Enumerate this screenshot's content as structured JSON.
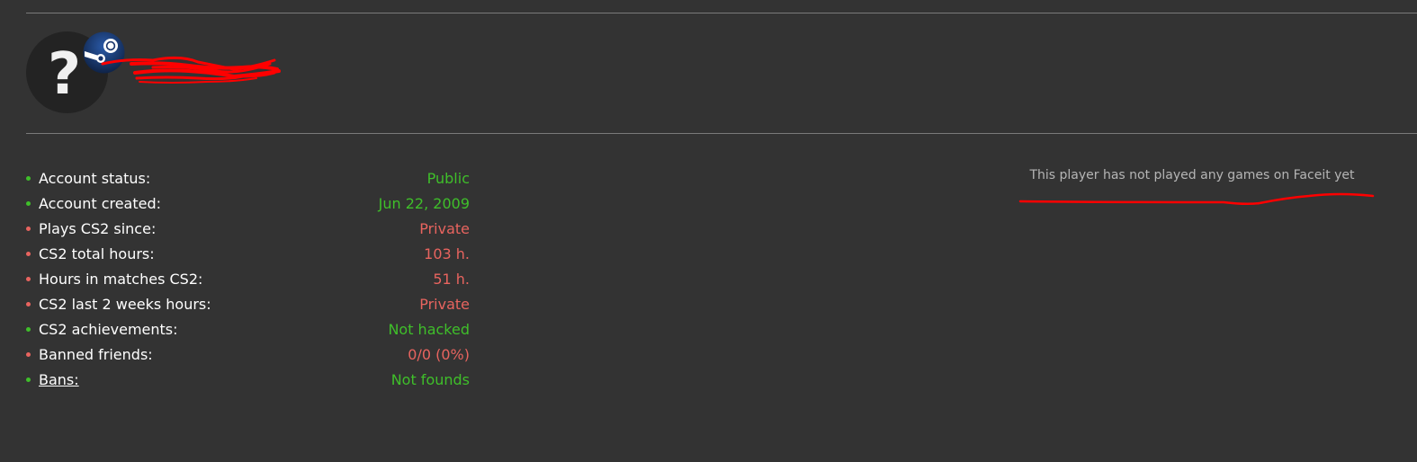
{
  "profile": {
    "avatar_glyph": "?",
    "badge_icon": "steam-icon",
    "name_redacted": true
  },
  "stats": [
    {
      "label": "Account status:",
      "value": "Public",
      "status": "good",
      "link": false
    },
    {
      "label": "Account created:",
      "value": "Jun 22, 2009",
      "status": "good",
      "link": false
    },
    {
      "label": "Plays CS2 since:",
      "value": "Private",
      "status": "bad",
      "link": false
    },
    {
      "label": "CS2 total hours:",
      "value": "103 h.",
      "status": "bad",
      "link": false
    },
    {
      "label": "Hours in matches CS2:",
      "value": "51 h.",
      "status": "bad",
      "link": false
    },
    {
      "label": "CS2 last 2 weeks hours:",
      "value": "Private",
      "status": "bad",
      "link": false
    },
    {
      "label": "CS2 achievements:",
      "value": "Not hacked",
      "status": "good",
      "link": false
    },
    {
      "label": "Banned friends:",
      "value": "0/0 (0%)",
      "status": "bad",
      "link": false
    },
    {
      "label": "Bans:",
      "value": "Not founds",
      "status": "good",
      "link": true
    }
  ],
  "faceit": {
    "message": "This player has not played any games on Faceit yet"
  },
  "colors": {
    "background": "#333333",
    "good": "#3fbf2a",
    "bad": "#e8645f",
    "muted": "#b5b5b5",
    "scribble": "#ff0000",
    "steam_badge": "#1b3f7a"
  }
}
